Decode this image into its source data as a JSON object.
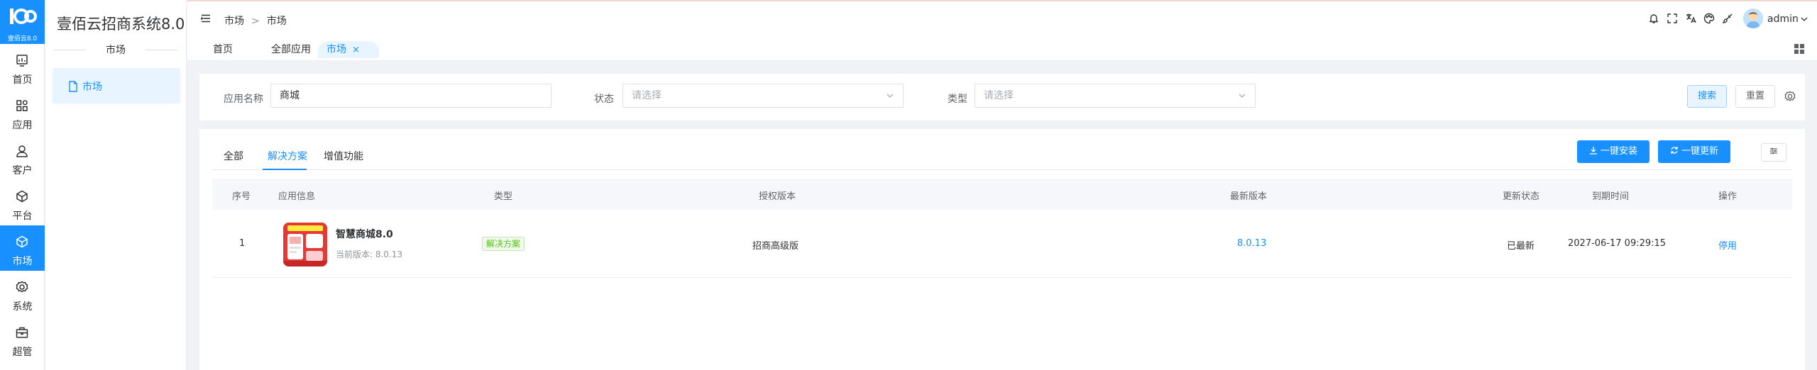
{
  "app": {
    "logo_text": "壹佰云8.0",
    "system_title": "壹佰云招商系统8.0"
  },
  "rail": {
    "items": [
      {
        "label": "首页",
        "icon": "dashboard-icon"
      },
      {
        "label": "应用",
        "icon": "apps-icon"
      },
      {
        "label": "客户",
        "icon": "user-icon"
      },
      {
        "label": "平台",
        "icon": "cube-icon"
      },
      {
        "label": "市场",
        "icon": "market-icon",
        "active": true
      },
      {
        "label": "系统",
        "icon": "gear-icon"
      },
      {
        "label": "超管",
        "icon": "briefcase-icon"
      }
    ]
  },
  "sidebar": {
    "group_title": "市场",
    "items": [
      {
        "label": "市场",
        "icon": "document-icon",
        "active": true
      }
    ]
  },
  "header": {
    "breadcrumb": [
      "市场",
      "市场"
    ],
    "breadcrumb_sep": ">",
    "user_name": "admin"
  },
  "tags": [
    {
      "label": "首页"
    },
    {
      "label": "全部应用"
    },
    {
      "label": "市场",
      "active": true,
      "close": "×"
    }
  ],
  "search": {
    "name_label": "应用名称",
    "name_value": "商城",
    "status_label": "状态",
    "status_placeholder": "请选择",
    "type_label": "类型",
    "type_placeholder": "请选择",
    "search_button": "搜索",
    "reset_button": "重置"
  },
  "main": {
    "tabs": [
      {
        "label": "全部"
      },
      {
        "label": "解决方案",
        "active": true
      },
      {
        "label": "增值功能"
      }
    ],
    "install_button": "一键安装",
    "update_button": "一键更新"
  },
  "table": {
    "columns": [
      "序号",
      "应用信息",
      "类型",
      "授权版本",
      "最新版本",
      "更新状态",
      "到期时间",
      "操作"
    ],
    "rows": [
      {
        "index": "1",
        "app_name": "智慧商城8.0",
        "current_version": "当前版本: 8.0.13",
        "type": "解决方案",
        "license": "招商高级版",
        "latest_version": "8.0.13",
        "update_status": "已最新",
        "expire_time": "2027-06-17 09:29:15",
        "action": "停用"
      }
    ]
  },
  "colors": {
    "primary": "#1890ff",
    "success": "#52c41a",
    "app_image_bg": "#e53935"
  }
}
